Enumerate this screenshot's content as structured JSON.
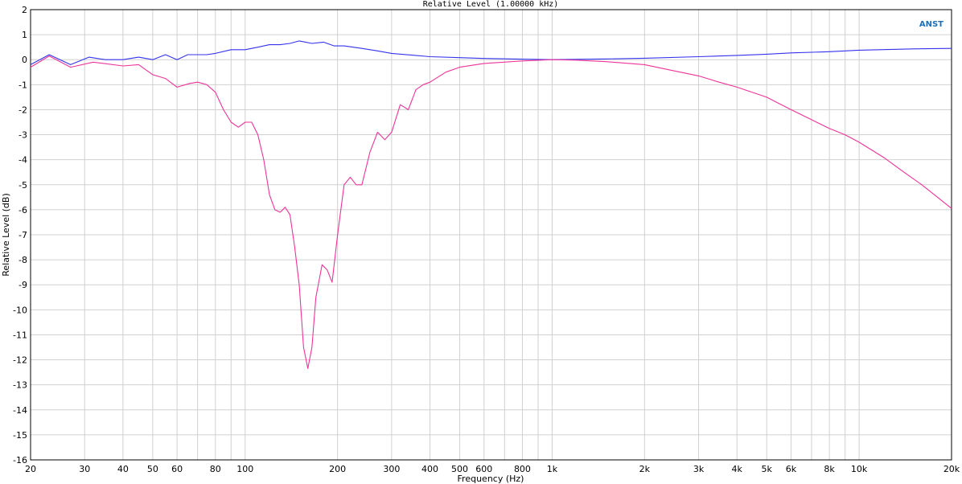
{
  "chart_data": {
    "type": "line",
    "title": "Relative Level (1.00000 kHz)",
    "brand": "ANST",
    "xlabel": "Frequency (Hz)",
    "ylabel": "Relative Level (dB)",
    "xscale": "log",
    "xlim": [
      20,
      20000
    ],
    "ylim": [
      -16,
      2
    ],
    "grid": true,
    "colors": {
      "blue": "#3333ee",
      "pink": "#ee3399",
      "grid": "#d0d0d0",
      "brand": "#1e6fb5"
    },
    "x_ticks": [
      {
        "v": 20,
        "label": "20"
      },
      {
        "v": 30,
        "label": "30"
      },
      {
        "v": 40,
        "label": "40"
      },
      {
        "v": 50,
        "label": "50"
      },
      {
        "v": 60,
        "label": "60"
      },
      {
        "v": 80,
        "label": "80"
      },
      {
        "v": 100,
        "label": "100"
      },
      {
        "v": 200,
        "label": "200"
      },
      {
        "v": 300,
        "label": "300"
      },
      {
        "v": 400,
        "label": "400"
      },
      {
        "v": 500,
        "label": "500"
      },
      {
        "v": 600,
        "label": "600"
      },
      {
        "v": 800,
        "label": "800"
      },
      {
        "v": 1000,
        "label": "1k"
      },
      {
        "v": 2000,
        "label": "2k"
      },
      {
        "v": 3000,
        "label": "3k"
      },
      {
        "v": 4000,
        "label": "4k"
      },
      {
        "v": 5000,
        "label": "5k"
      },
      {
        "v": 6000,
        "label": "6k"
      },
      {
        "v": 8000,
        "label": "8k"
      },
      {
        "v": 10000,
        "label": "10k"
      },
      {
        "v": 20000,
        "label": "20k"
      }
    ],
    "y_ticks": [
      {
        "v": 2,
        "label": "2"
      },
      {
        "v": 1,
        "label": "1"
      },
      {
        "v": 0,
        "label": "0"
      },
      {
        "v": -1,
        "label": "-1"
      },
      {
        "v": -2,
        "label": "-2"
      },
      {
        "v": -3,
        "label": "-3"
      },
      {
        "v": -4,
        "label": "-4"
      },
      {
        "v": -5,
        "label": "-5"
      },
      {
        "v": -6,
        "label": "-6"
      },
      {
        "v": -7,
        "label": "-7"
      },
      {
        "v": -8,
        "label": "-8"
      },
      {
        "v": -9,
        "label": "-9"
      },
      {
        "v": -10,
        "label": "-10"
      },
      {
        "v": -11,
        "label": "-11"
      },
      {
        "v": -12,
        "label": "-12"
      },
      {
        "v": -13,
        "label": "-13"
      },
      {
        "v": -14,
        "label": "-14"
      },
      {
        "v": -15,
        "label": "-15"
      },
      {
        "v": -16,
        "label": "-16"
      }
    ],
    "series": [
      {
        "color": "#3333ee",
        "points": [
          [
            20,
            -0.2
          ],
          [
            23,
            0.2
          ],
          [
            27,
            -0.2
          ],
          [
            31,
            0.1
          ],
          [
            35,
            0.0
          ],
          [
            40,
            0.0
          ],
          [
            45,
            0.1
          ],
          [
            50,
            0.0
          ],
          [
            55,
            0.2
          ],
          [
            60,
            0.0
          ],
          [
            65,
            0.2
          ],
          [
            70,
            0.2
          ],
          [
            75,
            0.2
          ],
          [
            80,
            0.25
          ],
          [
            90,
            0.4
          ],
          [
            100,
            0.4
          ],
          [
            110,
            0.5
          ],
          [
            120,
            0.6
          ],
          [
            130,
            0.6
          ],
          [
            140,
            0.65
          ],
          [
            150,
            0.75
          ],
          [
            165,
            0.65
          ],
          [
            180,
            0.7
          ],
          [
            195,
            0.55
          ],
          [
            210,
            0.55
          ],
          [
            240,
            0.45
          ],
          [
            270,
            0.35
          ],
          [
            300,
            0.25
          ],
          [
            350,
            0.18
          ],
          [
            400,
            0.12
          ],
          [
            500,
            0.08
          ],
          [
            600,
            0.05
          ],
          [
            800,
            0.02
          ],
          [
            1000,
            0.0
          ],
          [
            1500,
            0.03
          ],
          [
            2000,
            0.06
          ],
          [
            3000,
            0.12
          ],
          [
            4000,
            0.17
          ],
          [
            5000,
            0.22
          ],
          [
            6000,
            0.27
          ],
          [
            8000,
            0.32
          ],
          [
            10000,
            0.38
          ],
          [
            15000,
            0.43
          ],
          [
            20000,
            0.45
          ]
        ]
      },
      {
        "color": "#ee3399",
        "points": [
          [
            20,
            -0.3
          ],
          [
            23,
            0.15
          ],
          [
            27,
            -0.3
          ],
          [
            32,
            -0.1
          ],
          [
            40,
            -0.25
          ],
          [
            45,
            -0.2
          ],
          [
            50,
            -0.6
          ],
          [
            55,
            -0.75
          ],
          [
            60,
            -1.1
          ],
          [
            66,
            -0.95
          ],
          [
            70,
            -0.9
          ],
          [
            75,
            -1.0
          ],
          [
            80,
            -1.3
          ],
          [
            85,
            -2.0
          ],
          [
            90,
            -2.5
          ],
          [
            95,
            -2.7
          ],
          [
            100,
            -2.5
          ],
          [
            105,
            -2.5
          ],
          [
            110,
            -3.0
          ],
          [
            115,
            -4.0
          ],
          [
            120,
            -5.4
          ],
          [
            125,
            -6.0
          ],
          [
            130,
            -6.1
          ],
          [
            135,
            -5.9
          ],
          [
            140,
            -6.2
          ],
          [
            145,
            -7.5
          ],
          [
            150,
            -9.0
          ],
          [
            155,
            -11.5
          ],
          [
            160,
            -12.35
          ],
          [
            165,
            -11.5
          ],
          [
            170,
            -9.5
          ],
          [
            178,
            -8.2
          ],
          [
            185,
            -8.4
          ],
          [
            192,
            -8.9
          ],
          [
            200,
            -7.0
          ],
          [
            210,
            -5.0
          ],
          [
            220,
            -4.7
          ],
          [
            230,
            -5.0
          ],
          [
            240,
            -5.0
          ],
          [
            255,
            -3.7
          ],
          [
            270,
            -2.9
          ],
          [
            285,
            -3.2
          ],
          [
            300,
            -2.9
          ],
          [
            320,
            -1.8
          ],
          [
            340,
            -2.0
          ],
          [
            360,
            -1.2
          ],
          [
            380,
            -1.0
          ],
          [
            400,
            -0.9
          ],
          [
            450,
            -0.5
          ],
          [
            500,
            -0.3
          ],
          [
            600,
            -0.15
          ],
          [
            800,
            -0.05
          ],
          [
            1000,
            0.0
          ],
          [
            1200,
            -0.02
          ],
          [
            1500,
            -0.08
          ],
          [
            2000,
            -0.2
          ],
          [
            2500,
            -0.45
          ],
          [
            3000,
            -0.65
          ],
          [
            3500,
            -0.9
          ],
          [
            4000,
            -1.1
          ],
          [
            5000,
            -1.5
          ],
          [
            6000,
            -2.0
          ],
          [
            7000,
            -2.4
          ],
          [
            8000,
            -2.75
          ],
          [
            9000,
            -3.0
          ],
          [
            10000,
            -3.3
          ],
          [
            12000,
            -3.9
          ],
          [
            14000,
            -4.5
          ],
          [
            16000,
            -5.0
          ],
          [
            18000,
            -5.5
          ],
          [
            20000,
            -5.95
          ]
        ]
      }
    ]
  }
}
